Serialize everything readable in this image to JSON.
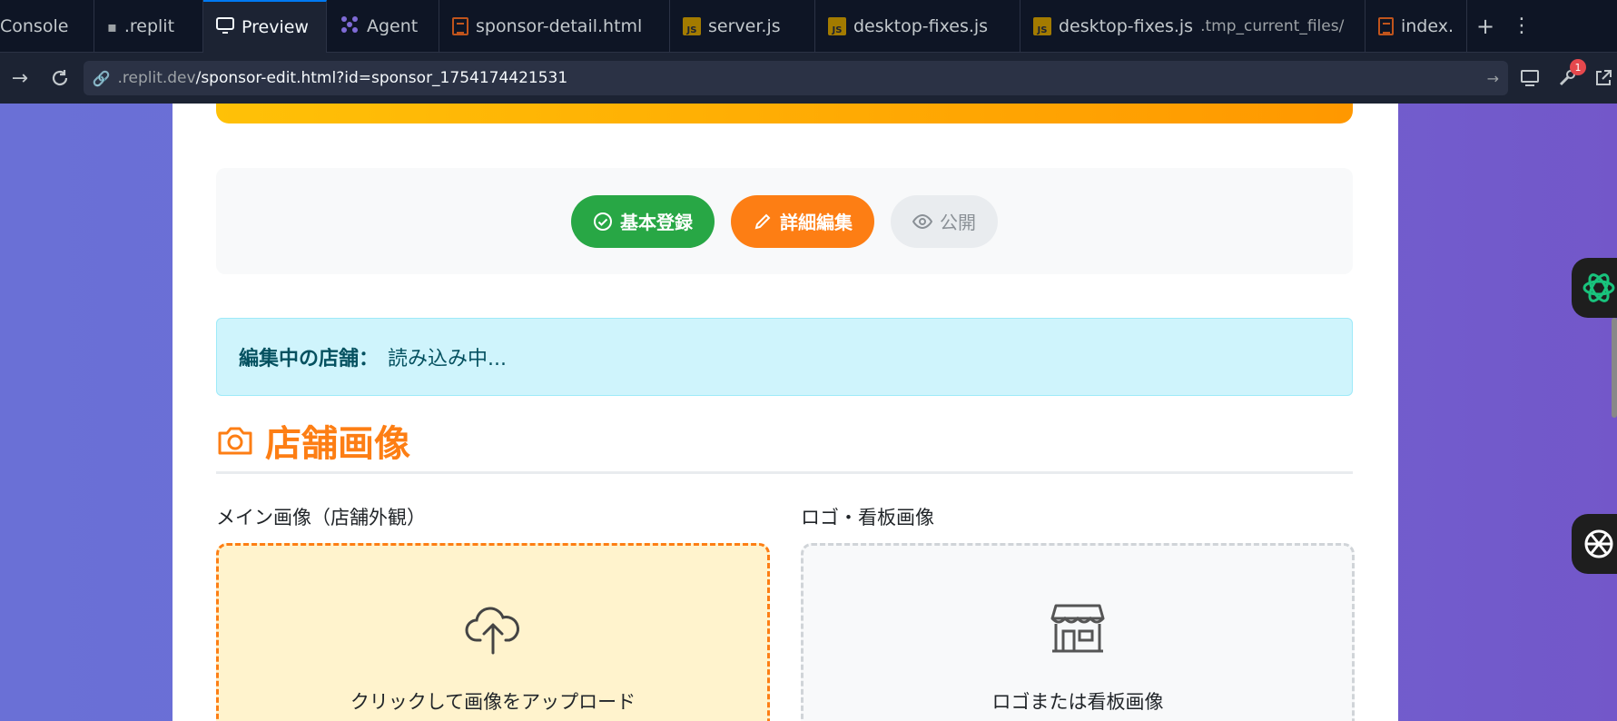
{
  "tabs": [
    {
      "label": "Console",
      "icon": "console-icon"
    },
    {
      "label": ".replit",
      "icon": "replit-config-icon"
    },
    {
      "label": "Preview",
      "icon": "monitor-icon",
      "active": true
    },
    {
      "label": "Agent",
      "icon": "agent-icon"
    },
    {
      "label": "sponsor-detail.html",
      "icon": "html-file-icon"
    },
    {
      "label": "server.js",
      "icon": "js-file-icon"
    },
    {
      "label": "desktop-fixes.js",
      "icon": "js-file-icon"
    },
    {
      "label": "desktop-fixes.js",
      "sub": ".tmp_current_files/",
      "icon": "js-file-icon"
    },
    {
      "label": "index.",
      "icon": "html-file-icon"
    }
  ],
  "url": {
    "host": ".replit.dev",
    "path": "/sponsor-edit.html?id=sponsor_1754174421531"
  },
  "toolbar": {
    "notification_count": "1"
  },
  "steps": [
    {
      "label": "基本登録",
      "state": "done",
      "icon": "check-circle-icon"
    },
    {
      "label": "詳細編集",
      "state": "current",
      "icon": "pencil-icon"
    },
    {
      "label": "公開",
      "state": "pending",
      "icon": "eye-icon"
    }
  ],
  "info": {
    "label": "編集中の店舗：",
    "value": "読み込み中..."
  },
  "section": {
    "title": "店舗画像"
  },
  "uploads": {
    "main_label": "メイン画像（店舗外観）",
    "main_text": "クリックして画像をアップロード",
    "logo_label": "ロゴ・看板画像",
    "logo_text": "ロゴまたは看板画像"
  },
  "colors": {
    "accent_orange": "#fd7e14",
    "success_green": "#28a745",
    "info_bg": "#cff4fc"
  }
}
